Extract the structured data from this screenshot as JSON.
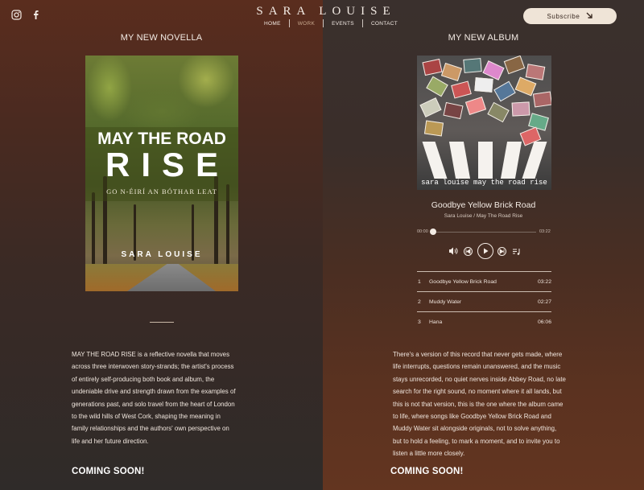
{
  "header": {
    "brand": "SARA LOUISE",
    "nav": [
      "HOME",
      "WORK",
      "EVENTS",
      "CONTACT"
    ],
    "active_nav": "WORK",
    "subscribe_label": "Subscribe",
    "icons": [
      "instagram-icon",
      "facebook-icon",
      "arrow-down-right-icon"
    ]
  },
  "novella": {
    "section_title": "MY NEW NOVELLA",
    "cover": {
      "title_line1": "MAY THE ROAD",
      "title_line2": "RISE",
      "subtitle": "GO N-ÉIRÍ AN BÓTHAR LEAT",
      "author": "SARA LOUISE"
    },
    "description": [
      "MAY THE ROAD RISE is a reflective novella that moves",
      "across three interwoven story-strands; the artist's process",
      "of entirely self-producing both book and album, the",
      "undeniable drive and strength drawn from the examples of",
      "generations past, and solo travel from the heart of London",
      "to the wild hills of West Cork, shaping the meaning in",
      "family relationships and the authors' own perspective on",
      "life and her future direction."
    ],
    "coming_soon": "COMING SOON!"
  },
  "album": {
    "section_title": "MY NEW ALBUM",
    "cover_caption": "sara louise   may the road rise",
    "now_playing": {
      "title": "Goodbye Yellow Brick Road",
      "subtitle": "Sara Louise / May The Road Rise",
      "elapsed": "00:00",
      "duration": "03:22",
      "progress": 0
    },
    "tracks": [
      {
        "num": "1",
        "name": "Goodbye Yellow Brick Road",
        "dur": "03:22"
      },
      {
        "num": "2",
        "name": "Muddy Water",
        "dur": "02:27"
      },
      {
        "num": "3",
        "name": "Hana",
        "dur": "06:06"
      }
    ],
    "description": [
      "There's a version of this record that never gets made, where",
      "life interrupts, questions remain unanswered, and the music",
      "stays unrecorded, no quiet nerves inside Abbey Road, no late",
      "search for the right sound, no moment where it all lands, but",
      "this is not that version, this is the one where the album came",
      "to life, where songs like Goodbye Yellow Brick Road and",
      "Muddy Water sit alongside originals, not to solve anything,",
      "but to hold a feeling, to mark a moment, and to invite you to",
      "listen a little more closely."
    ],
    "coming_soon": "COMING SOON!"
  },
  "colors": {
    "left_bg": "#4a2a20",
    "right_bg": "#5b3220",
    "subscribe_bg": "#efe4d7",
    "active_nav": "#c9a98e"
  }
}
